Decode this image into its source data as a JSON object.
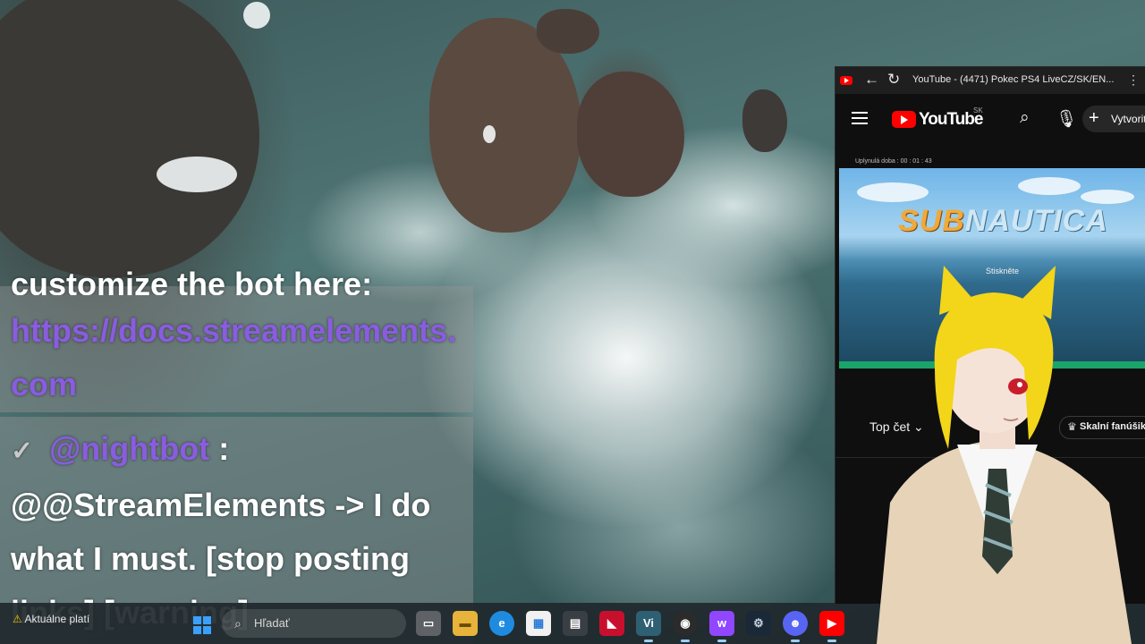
{
  "chat_overlay": {
    "prev_message_tail": "customize the bot here:",
    "link_text": "https://docs.streamelements.com",
    "message": {
      "check_glyph": "✓",
      "username": "@nightbot",
      "separator": " :",
      "text": "@@StreamElements -> I do what I must. [stop posting links] [warning]"
    }
  },
  "taskbar": {
    "weather_label": "Aktuálne platí",
    "search_placeholder": "Hľadať",
    "apps": [
      {
        "name": "task-view",
        "glyph": "▭"
      },
      {
        "name": "file-explorer",
        "glyph": "▬"
      },
      {
        "name": "edge",
        "glyph": "e"
      },
      {
        "name": "microsoft-store",
        "glyph": "▦"
      },
      {
        "name": "terminal",
        "glyph": "▤"
      },
      {
        "name": "amd",
        "glyph": "◣"
      },
      {
        "name": "vtube",
        "glyph": "Vi"
      },
      {
        "name": "obs",
        "glyph": "◉"
      },
      {
        "name": "twitch",
        "glyph": "w"
      },
      {
        "name": "steam",
        "glyph": "⚙"
      },
      {
        "name": "discord",
        "glyph": "☻"
      },
      {
        "name": "youtube",
        "glyph": "▶"
      }
    ]
  },
  "browser": {
    "window_title": "YouTube - (4471) Pokec PS4 LiveCZ/SK/EN...",
    "brand": "YouTube",
    "region": "SK",
    "create_label": "Vytvoriť",
    "elapsed_label": "Uplynulá doba : 00 : 01 : 43",
    "game_logo_a": "SUB",
    "game_logo_b": "NAUTICA",
    "press_hint": "Stiskněte",
    "chat_filter": "Top čet",
    "fan_chip": "Skalní fanúšikovia"
  },
  "colors": {
    "username": "#8a5ce0",
    "youtube_red": "#ff0000",
    "progress": "#1aa46a"
  }
}
